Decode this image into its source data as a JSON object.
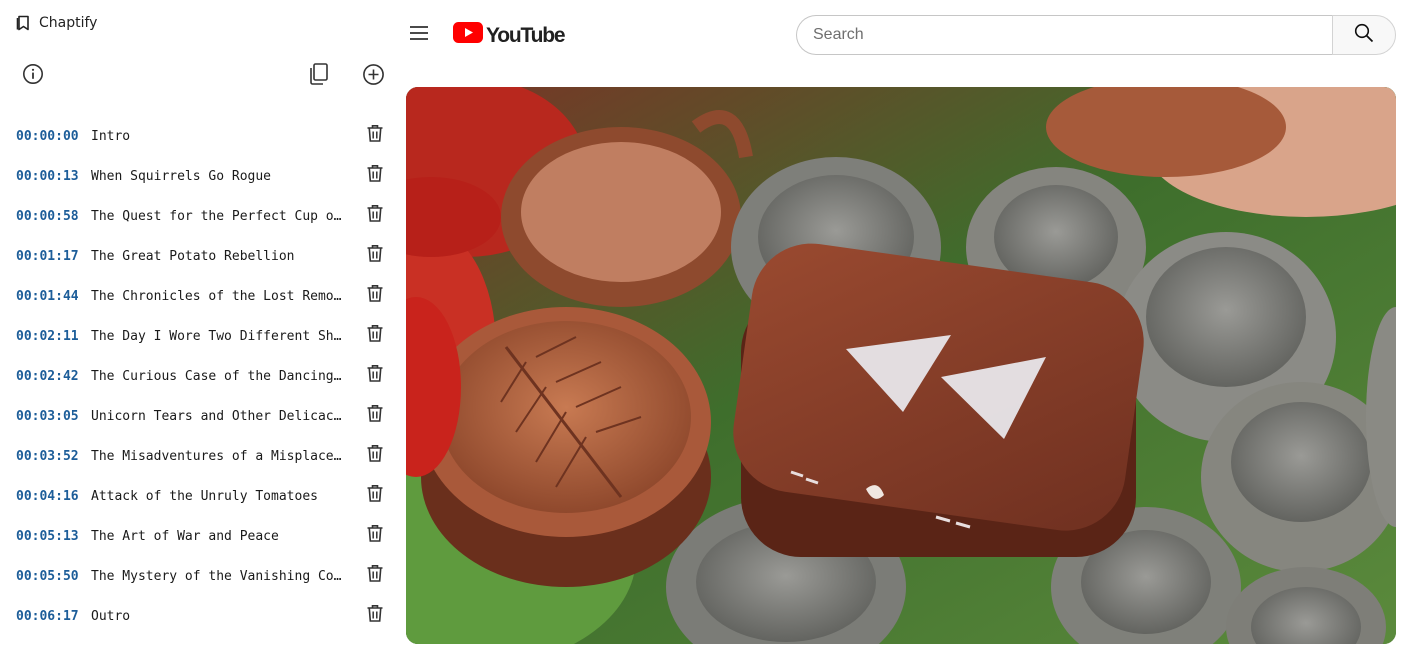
{
  "extension": {
    "app_title": "Chaptify",
    "toolbar": {
      "info_icon": "info-circle-icon",
      "copy_icon": "copy-icon",
      "add_icon": "plus-circle-icon"
    },
    "chapters": [
      {
        "time": "00:00:00",
        "title": "Intro"
      },
      {
        "time": "00:00:13",
        "title": "When Squirrels Go Rogue"
      },
      {
        "time": "00:00:58",
        "title": "The Quest for the Perfect Cup o..."
      },
      {
        "time": "00:01:17",
        "title": "The Great Potato Rebellion"
      },
      {
        "time": "00:01:44",
        "title": "The Chronicles of the Lost Remote"
      },
      {
        "time": "00:02:11",
        "title": "The Day I Wore Two Different Sh..."
      },
      {
        "time": "00:02:42",
        "title": "The Curious Case of the Dancing..."
      },
      {
        "time": "00:03:05",
        "title": "Unicorn Tears and Other Delicac..."
      },
      {
        "time": "00:03:52",
        "title": "The Misadventures of a Misplace..."
      },
      {
        "time": "00:04:16",
        "title": "Attack of the Unruly Tomatoes"
      },
      {
        "time": "00:05:13",
        "title": "The Art of War and Peace"
      },
      {
        "time": "00:05:50",
        "title": "The Mystery of the Vanishing Co..."
      },
      {
        "time": "00:06:17",
        "title": "Outro"
      }
    ]
  },
  "youtube": {
    "logo_text": "YouTube",
    "search": {
      "placeholder": "Search",
      "value": ""
    },
    "colors": {
      "brand_red": "#ff0000",
      "time_blue": "#1c5d99"
    }
  }
}
